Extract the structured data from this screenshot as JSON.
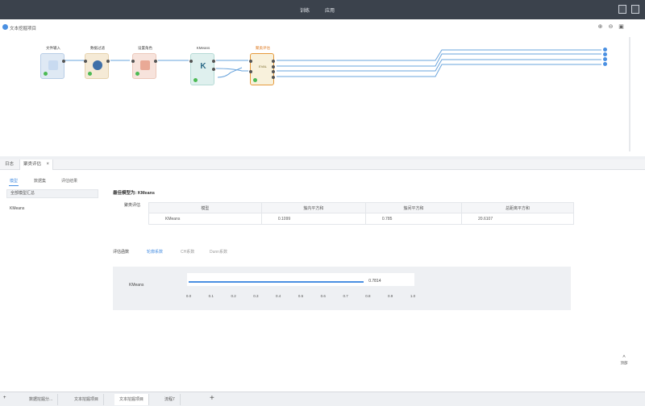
{
  "topbar": {
    "tab1": "训练",
    "tab2": "应用"
  },
  "canvas": {
    "title": "文本挖掘项目",
    "nodes": [
      {
        "label": "文件输入"
      },
      {
        "label": "数据过滤"
      },
      {
        "label": "设置角色"
      },
      {
        "label": "KMeans",
        "glyph": "K"
      },
      {
        "label": "聚类评估",
        "glyph": "EVAL"
      }
    ]
  },
  "bottom_panel": {
    "tabs": [
      "日志",
      "聚类评估"
    ],
    "subtabs": [
      "模型",
      "数据集",
      "评估结果"
    ],
    "summary": "全部模型汇总",
    "model_item": "KMeans",
    "best_model": "最佳模型为: KMeans",
    "table_title": "聚类评估",
    "table": {
      "headers": [
        "模型",
        "簇内平方和",
        "簇间平方和",
        "总距离平方和"
      ],
      "rows": [
        [
          "KMeans",
          "0.1099",
          "0.785",
          "20.6107"
        ]
      ]
    },
    "eval_tabs": [
      "评估函数",
      "轮廓系数",
      "CH系数",
      "Dunn系数"
    ]
  },
  "chart_data": {
    "type": "bar",
    "orientation": "horizontal",
    "categories": [
      "KMeans"
    ],
    "values": [
      0.7814
    ],
    "value_labels": [
      "0.7814"
    ],
    "xlim": [
      0,
      1
    ],
    "xticks": [
      "0.0",
      "0.1",
      "0.2",
      "0.3",
      "0.4",
      "0.5",
      "0.6",
      "0.7",
      "0.8",
      "0.9",
      "1.0"
    ],
    "bar_color": "#4a90e2"
  },
  "float_button": {
    "label": "顶部"
  },
  "bottom_tabs": [
    "数据挖掘分...",
    "文本挖掘项目",
    "文本挖掘项目",
    "流程7"
  ]
}
